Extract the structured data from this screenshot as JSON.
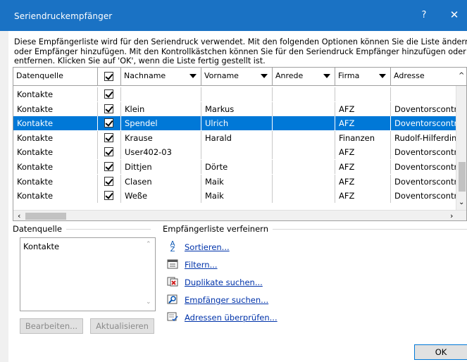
{
  "window": {
    "title": "Seriendruckempfänger",
    "help": "?",
    "close": "✕"
  },
  "description": {
    "line1": "Diese Empfängerliste wird für den Seriendruck verwendet. Mit den folgenden Optionen können Sie die Liste ändern",
    "line2": "oder Empfänger hinzufügen. Mit den Kontrollkästchen können Sie für den Seriendruck Empfänger hinzufügen oder",
    "line3": "entfernen. Klicken Sie auf 'OK', wenn die Liste fertig gestellt ist."
  },
  "table": {
    "columns": {
      "source": "Datenquelle",
      "lastname": "Nachname",
      "firstname": "Vorname",
      "salutation": "Anrede",
      "company": "Firma",
      "address": "Adresse"
    },
    "rows": [
      {
        "source": "Kontakte",
        "checked": true,
        "lastname": "",
        "firstname": "",
        "salutation": "",
        "company": "",
        "address": ""
      },
      {
        "source": "Kontakte",
        "checked": true,
        "lastname": "Klein",
        "firstname": "Markus",
        "salutation": "",
        "company": "AFZ",
        "address": "Doventorscontr"
      },
      {
        "source": "Kontakte",
        "checked": true,
        "lastname": "Spendel",
        "firstname": "Ulrich",
        "salutation": "",
        "company": "AFZ",
        "address": "Doventorscontr"
      },
      {
        "source": "Kontakte",
        "checked": true,
        "lastname": "Krause",
        "firstname": "Harald",
        "salutation": "",
        "company": "Finanzen",
        "address": "Rudolf-Hilferdin"
      },
      {
        "source": "Kontakte",
        "checked": true,
        "lastname": "User402-03",
        "firstname": "",
        "salutation": "",
        "company": "AFZ",
        "address": "Doventorscontr"
      },
      {
        "source": "Kontakte",
        "checked": true,
        "lastname": "Dittjen",
        "firstname": "Dörte",
        "salutation": "",
        "company": "AFZ",
        "address": "Doventorscontr"
      },
      {
        "source": "Kontakte",
        "checked": true,
        "lastname": "Clasen",
        "firstname": "Maik",
        "salutation": "",
        "company": "AFZ",
        "address": "Doventorscontr"
      },
      {
        "source": "Kontakte",
        "checked": true,
        "lastname": "Weße",
        "firstname": "Maik",
        "salutation": "",
        "company": "AFZ",
        "address": "Doventorscontr"
      }
    ],
    "selected_row": 2
  },
  "datasource": {
    "label": "Datenquelle",
    "items": [
      "Kontakte"
    ],
    "edit_button": "Bearbeiten...",
    "refresh_button": "Aktualisieren"
  },
  "refine": {
    "label": "Empfängerliste verfeinern",
    "sort": "Sortieren...",
    "filter": "Filtern...",
    "duplicates": "Duplikate suchen...",
    "find": "Empfänger suchen...",
    "validate": "Adressen überprüfen..."
  },
  "ok_button": "OK",
  "colors": {
    "titlebar": "#1a72c4",
    "selection": "#0078d7",
    "link": "#0033aa"
  }
}
